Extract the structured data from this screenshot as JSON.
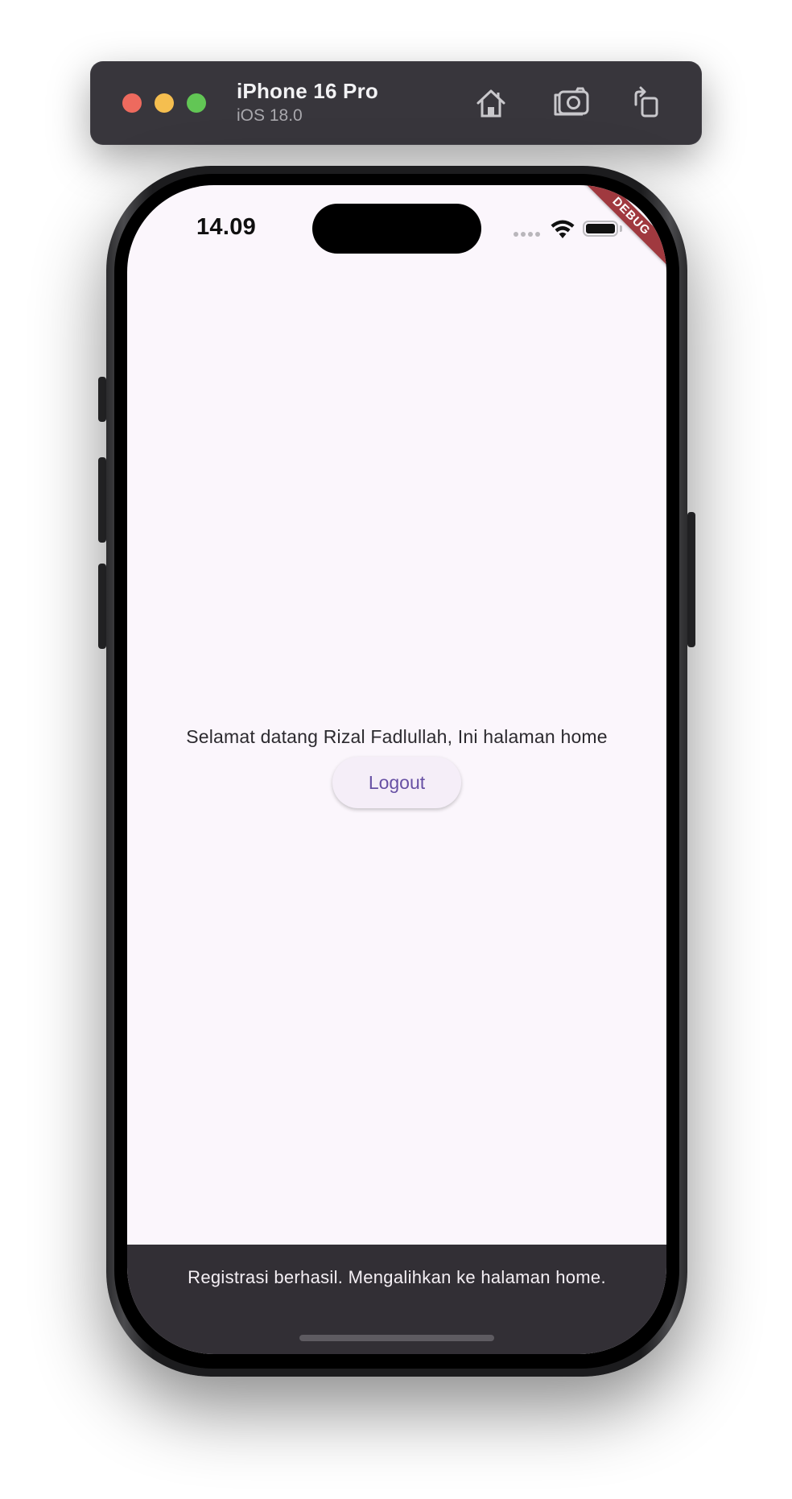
{
  "simulator": {
    "device_name": "iPhone 16 Pro",
    "os_version": "iOS 18.0",
    "toolbar_icons": [
      "home-icon",
      "screenshot-icon",
      "rotate-icon"
    ]
  },
  "status_bar": {
    "time": "14.09",
    "debug_label": "DEBUG"
  },
  "home": {
    "welcome_text": "Selamat datang Rizal Fadlullah, Ini halaman home",
    "logout_label": "Logout"
  },
  "snackbar": {
    "message": "Registrasi berhasil. Mengalihkan ke halaman home."
  },
  "colors": {
    "screen_background": "#fbf6fc",
    "button_text": "#6750a4",
    "snackbar_background": "#322f35",
    "debug_banner": "#a0393f"
  }
}
